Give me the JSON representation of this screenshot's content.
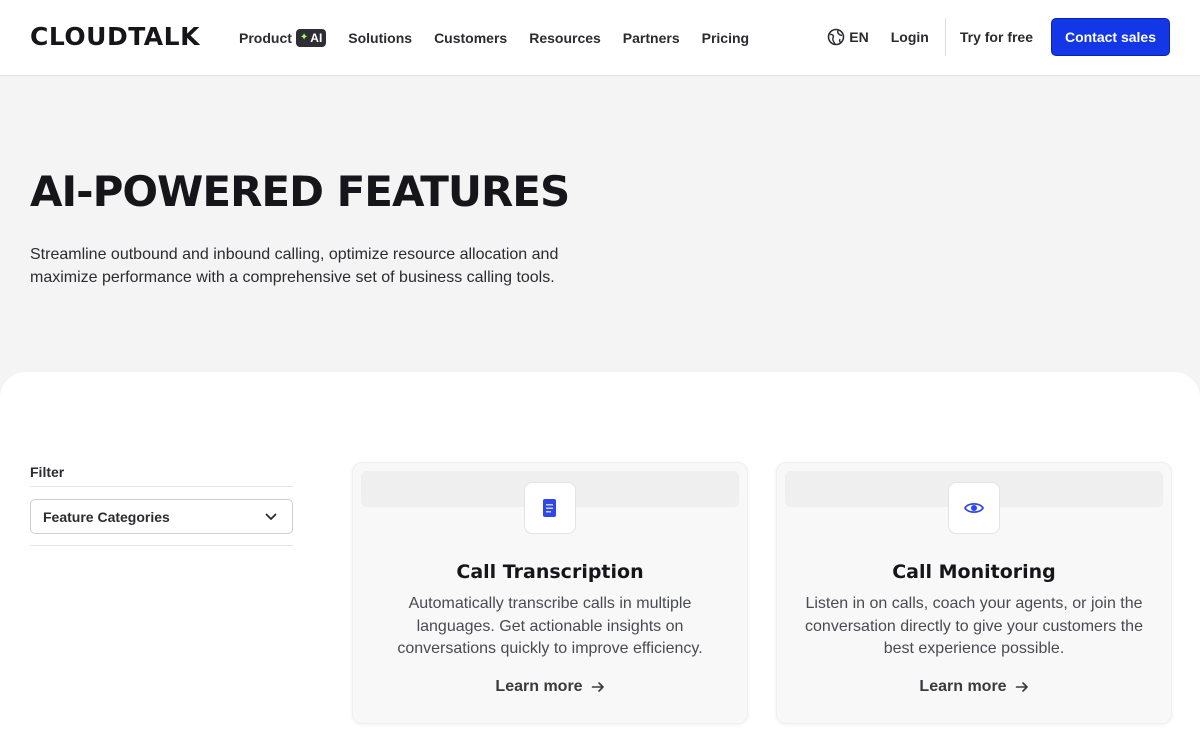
{
  "header": {
    "logo": "CLOUDTALK",
    "nav": [
      {
        "label": "Product",
        "badge": "AI"
      },
      {
        "label": "Solutions"
      },
      {
        "label": "Customers"
      },
      {
        "label": "Resources"
      },
      {
        "label": "Partners"
      },
      {
        "label": "Pricing"
      }
    ],
    "language": "EN",
    "login": "Login",
    "try_free": "Try for free",
    "contact_sales": "Contact sales",
    "accent_color": "#1336e6"
  },
  "hero": {
    "title": "AI-POWERED FEATURES",
    "description": "Streamline outbound and inbound calling, optimize resource allocation and maximize performance with a comprehensive set of business calling tools."
  },
  "filter": {
    "label": "Filter",
    "select_value": "Feature Categories"
  },
  "cards": [
    {
      "icon": "document-icon",
      "title": "Call Transcription",
      "description": "Automatically transcribe calls in multiple languages. Get actionable insights on conversations quickly to improve efficiency.",
      "link": "Learn more"
    },
    {
      "icon": "eye-icon",
      "title": "Call Monitoring",
      "description": "Listen in on calls, coach your agents, or join the conversation directly to give your customers the best experience possible.",
      "link": "Learn more"
    }
  ]
}
